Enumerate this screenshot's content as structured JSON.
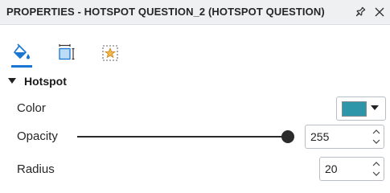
{
  "header": {
    "title": "PROPERTIES - HOTSPOT QUESTION_2 (HOTSPOT QUESTION)",
    "pin_icon": "pin-icon",
    "close_icon": "close-icon"
  },
  "tabs": [
    {
      "icon": "paint-bucket-icon",
      "active": true
    },
    {
      "icon": "size-position-icon",
      "active": false
    },
    {
      "icon": "star-effect-icon",
      "active": false
    }
  ],
  "section": {
    "title": "Hotspot",
    "expanded": true
  },
  "fields": {
    "color": {
      "label": "Color",
      "value": "#2e96a9"
    },
    "opacity": {
      "label": "Opacity",
      "value": "255",
      "min": 0,
      "max": 255
    },
    "radius": {
      "label": "Radius",
      "value": "20"
    }
  },
  "colors": {
    "accent": "#1976d2",
    "swatch": "#2e96a9"
  }
}
